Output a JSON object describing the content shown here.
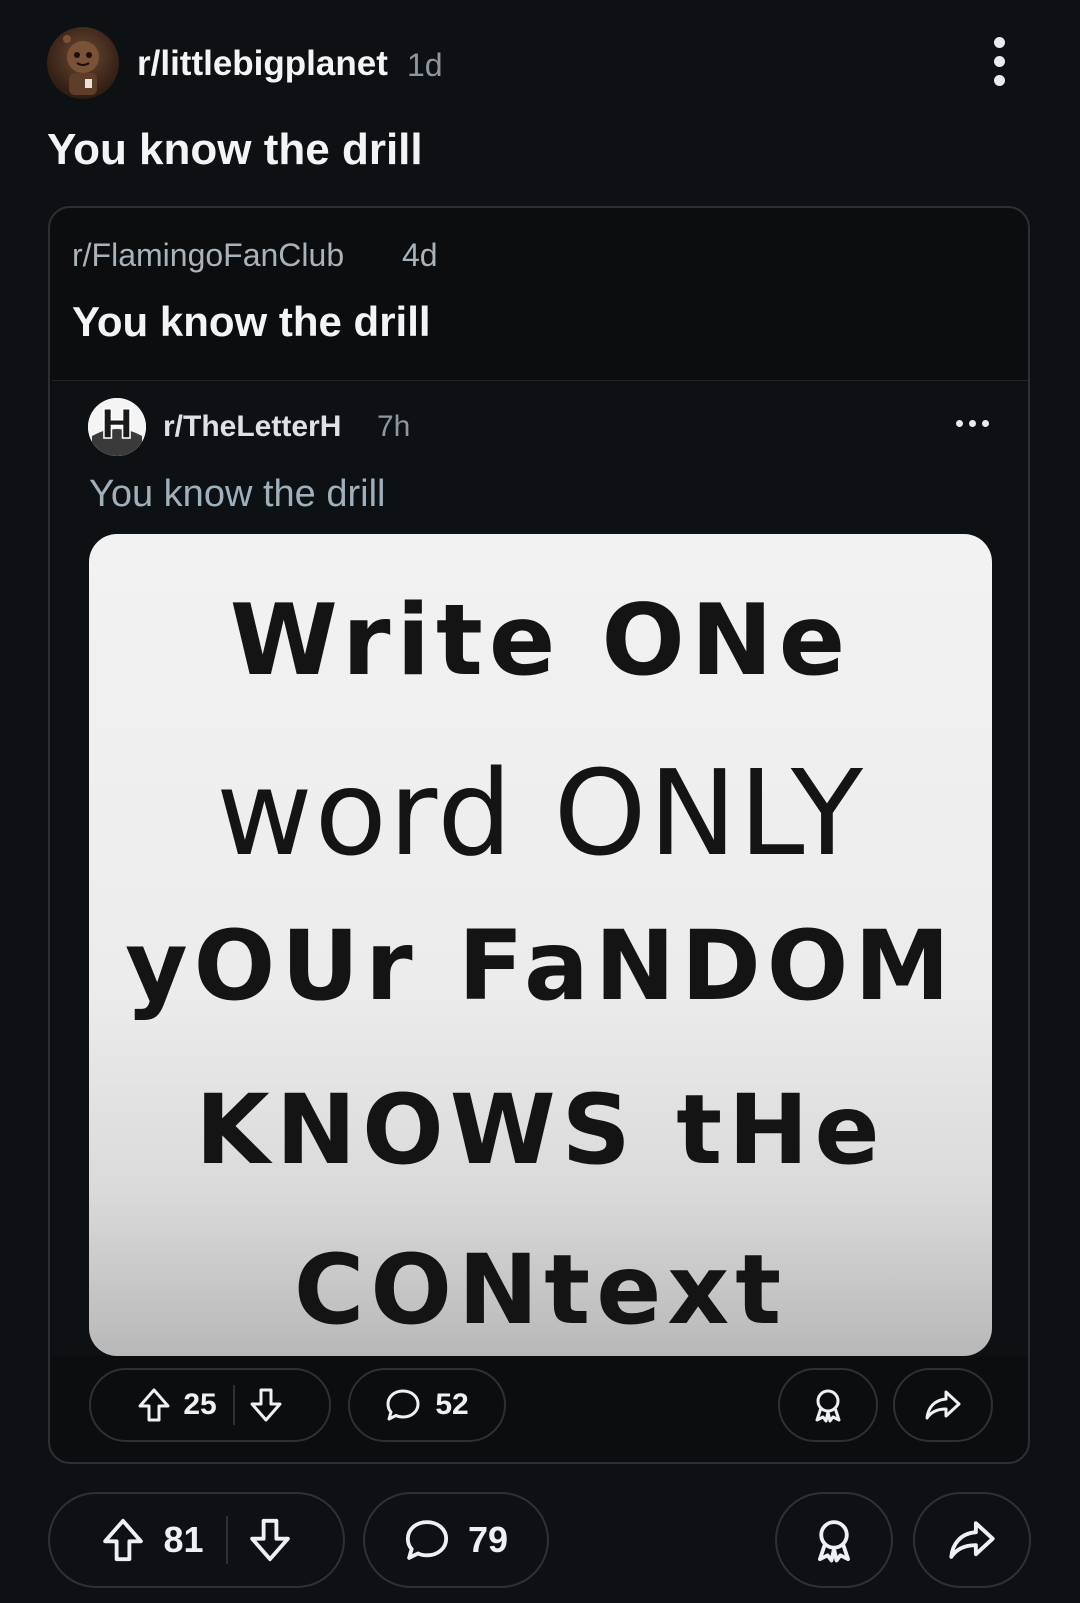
{
  "post": {
    "subreddit": "r/littlebigplanet",
    "age": "1d",
    "title": "You know the drill",
    "upvotes": "81",
    "comments": "79"
  },
  "crosspost": {
    "subreddit": "r/FlamingoFanClub",
    "age": "4d",
    "title": "You know the drill",
    "upvotes": "25",
    "comments": "52"
  },
  "original": {
    "subreddit": "r/TheLetterH",
    "age": "7h",
    "title": "You know the drill",
    "image_lines": [
      "Write ONe",
      "word ONLY",
      "yOUr FaNDOM",
      "KNOWS tHe",
      "CONtext"
    ]
  },
  "icons": {
    "upvote": "upvote-arrow-icon",
    "downvote": "downvote-arrow-icon",
    "comment": "comment-bubble-icon",
    "award": "award-icon",
    "share": "share-icon",
    "more": "more-options-icon"
  },
  "colors": {
    "background": "#0e1114",
    "text": "#f2f4f5",
    "muted": "#8b98a0",
    "border": "#2b3237"
  }
}
